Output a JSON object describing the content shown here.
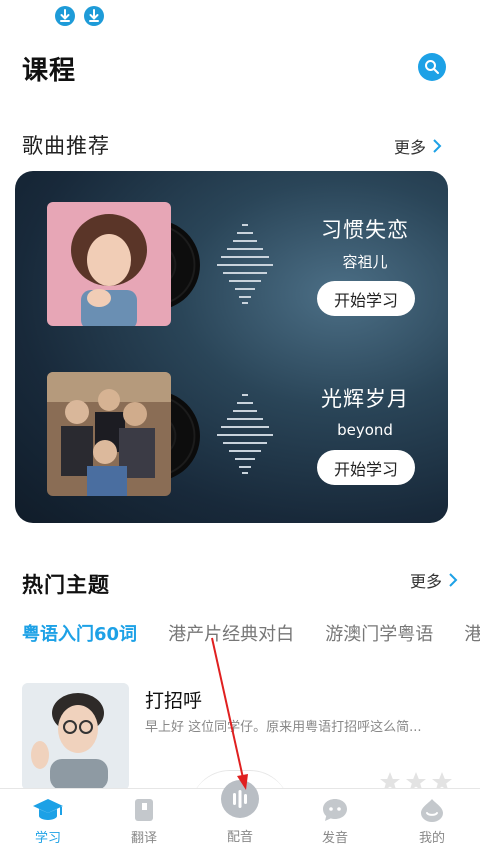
{
  "header": {
    "title": "课程"
  },
  "songs_section": {
    "title": "歌曲推荐",
    "more_label": "更多",
    "songs": [
      {
        "title": "习惯失恋",
        "artist": "容祖儿",
        "button": "开始学习"
      },
      {
        "title": "光辉岁月",
        "artist": "beyond",
        "button": "开始学习"
      }
    ]
  },
  "topics_section": {
    "title": "热门主题",
    "more_label": "更多",
    "tabs": [
      "粤语入门60词",
      "港产片经典对白",
      "游澳门学粤语",
      "港"
    ]
  },
  "lesson": {
    "title": "打招呼",
    "description": "早上好 这位同学仔。原来用粤语打招呼这么简..."
  },
  "bottom_nav": {
    "items": [
      "学习",
      "翻译",
      "配音",
      "发音",
      "我的"
    ]
  },
  "colors": {
    "accent": "#1da1e6",
    "inactive": "#888888"
  }
}
